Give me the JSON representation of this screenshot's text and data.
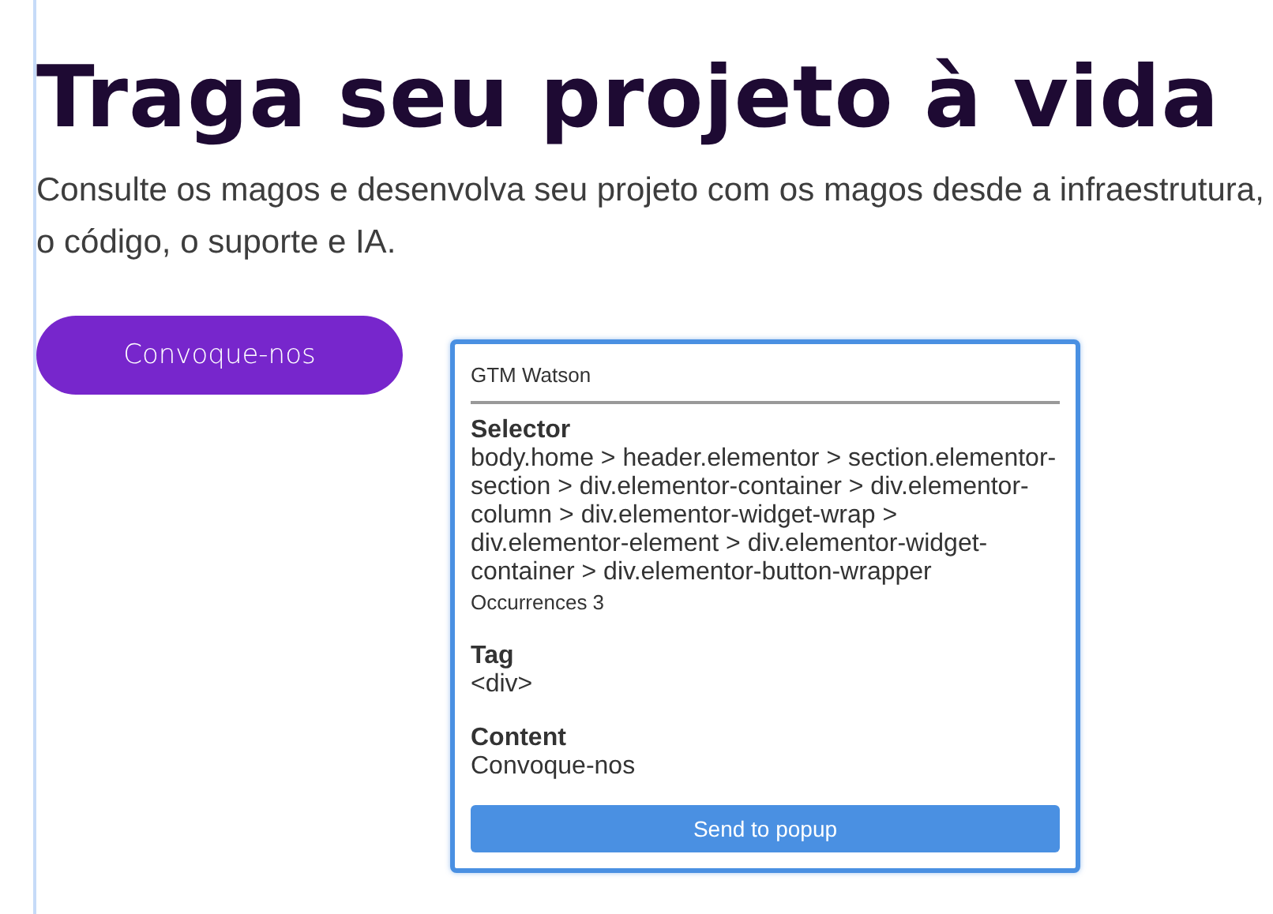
{
  "hero": {
    "title": "Traga seu projeto à vida",
    "subtitle": "Consulte os magos e desenvolva seu projeto com os magos desde a infraestrutura, o código, o suporte e IA.",
    "button": "Convoque-nos"
  },
  "popup": {
    "title": "GTM Watson",
    "sections": [
      {
        "label": "Selector",
        "value": "body.home > header.elementor > section.elementor-section > div.elementor-container > div.elementor-column > div.elementor-widget-wrap > div.elementor-element > div.elementor-widget-container > div.elementor-button-wrapper",
        "note": "Occurrences 3"
      },
      {
        "label": "Tag",
        "value": "<div>"
      },
      {
        "label": "Content",
        "value": "Convoque-nos"
      }
    ],
    "button": "Send to popup"
  }
}
